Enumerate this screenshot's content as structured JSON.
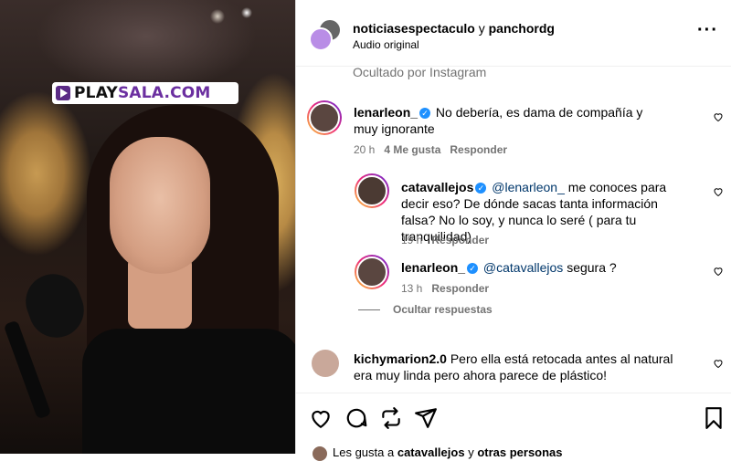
{
  "video": {
    "watermark_left": "PLAY",
    "watermark_right": "SALA.COM"
  },
  "header": {
    "user1": "noticiasespectaculo",
    "conj": "y",
    "user2": "panchordg",
    "audio": "Audio original"
  },
  "hidden_note": "Ocultado por Instagram",
  "comments": [
    {
      "user": "lenarleon_",
      "text": "No debería, es dama de compañía y muy ignorante",
      "time": "20 h",
      "likes": "4 Me gusta",
      "reply": "Responder"
    },
    {
      "user": "catavallejos",
      "mention": "@lenarleon_",
      "text": "me conoces para decir eso? De dónde sacas tanta información falsa? No lo soy, y nunca lo seré ( para tu tranquilidad)",
      "time": "19 h",
      "reply": "Responder"
    },
    {
      "user": "lenarleon_",
      "mention": "@catavallejos",
      "text": "segura ?",
      "time": "13 h",
      "reply": "Responder"
    },
    {
      "user": "kichymarion2.0",
      "text": "Pero ella está retocada antes al natural era muy linda pero ahora parece de plástico!"
    }
  ],
  "hide_replies": "Ocultar respuestas",
  "likes_line": {
    "prefix": "Les gusta a",
    "user": "catavallejos",
    "conj": "y",
    "others": "otras personas"
  },
  "icons": [
    "heart-icon",
    "comment-icon",
    "repost-icon",
    "share-icon",
    "bookmark-icon",
    "more-icon",
    "verified-icon"
  ]
}
